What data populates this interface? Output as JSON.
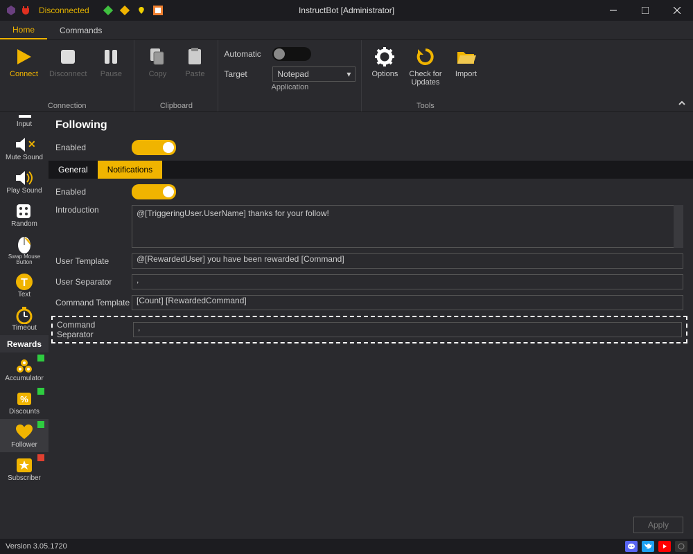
{
  "titlebar": {
    "status": "Disconnected",
    "title": "InstructBot [Administrator]"
  },
  "mainTabs": {
    "home": "Home",
    "commands": "Commands"
  },
  "ribbon": {
    "connection": {
      "connect": "Connect",
      "disconnect": "Disconnect",
      "pause": "Pause",
      "group": "Connection"
    },
    "clipboard": {
      "copy": "Copy",
      "paste": "Paste",
      "group": "Clipboard"
    },
    "application": {
      "automatic": "Automatic",
      "target": "Target",
      "targetValue": "Notepad",
      "group": "Application"
    },
    "tools": {
      "options": "Options",
      "check": "Check for\nUpdates",
      "import": "Import",
      "group": "Tools"
    }
  },
  "sidebar": {
    "input": "Input",
    "muteSound": "Mute Sound",
    "playSound": "Play Sound",
    "random": "Random",
    "swapMouse": "Swap Mouse\nButton",
    "text": "Text",
    "timeout": "Timeout",
    "rewardsHeader": "Rewards",
    "accumulator": "Accumulator",
    "discounts": "Discounts",
    "follower": "Follower",
    "subscriber": "Subscriber"
  },
  "page": {
    "title": "Following",
    "enabled": "Enabled",
    "tabGeneral": "General",
    "tabNotifications": "Notifications",
    "notifEnabled": "Enabled",
    "introductionLabel": "Introduction",
    "introductionValue": "@[TriggeringUser.UserName] thanks for your follow!",
    "userTemplateLabel": "User Template",
    "userTemplateValue": "@[RewardedUser] you have been rewarded [Command]",
    "userSeparatorLabel": "User Separator",
    "userSeparatorValue": ",",
    "commandTemplateLabel": "Command Template",
    "commandTemplateValue": "[Count] [RewardedCommand]",
    "commandSeparatorLabel": "Command Separator",
    "commandSeparatorValue": ",",
    "apply": "Apply"
  },
  "statusbar": {
    "version": "Version 3.05.1720"
  }
}
